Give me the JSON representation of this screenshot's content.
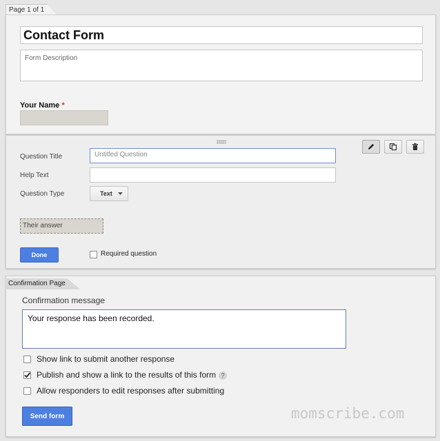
{
  "page_tab": "Page 1 of 1",
  "form": {
    "title": "Contact Form",
    "description_placeholder": "Form Description",
    "name_question": {
      "label": "Your Name",
      "required_mark": "*"
    }
  },
  "editor": {
    "labels": {
      "question_title": "Question Title",
      "help_text": "Help Text",
      "question_type": "Question Type"
    },
    "question_title_placeholder": "Untitled Question",
    "help_text_value": "",
    "question_type_value": "Text",
    "answer_preview": "Their answer",
    "done_label": "Done",
    "required_label": "Required question",
    "required_checked": false,
    "tool_icons": [
      "pencil-icon",
      "duplicate-icon",
      "trash-icon"
    ]
  },
  "confirmation": {
    "tab_label": "Confirmation Page",
    "message_label": "Confirmation message",
    "message_value": "Your response has been recorded.",
    "options": [
      {
        "label": "Show link to submit another response",
        "checked": false,
        "help": ""
      },
      {
        "label": "Publish and show a link to the results of this form",
        "checked": true,
        "help": "?"
      },
      {
        "label": "Allow responders to edit responses after submitting",
        "checked": false,
        "help": ""
      }
    ],
    "send_label": "Send form"
  },
  "watermark": "momscribe.com",
  "colors": {
    "primary_button": "#4d7fe0",
    "focus_border": "#6d8fc9",
    "required_star": "#c53929"
  }
}
